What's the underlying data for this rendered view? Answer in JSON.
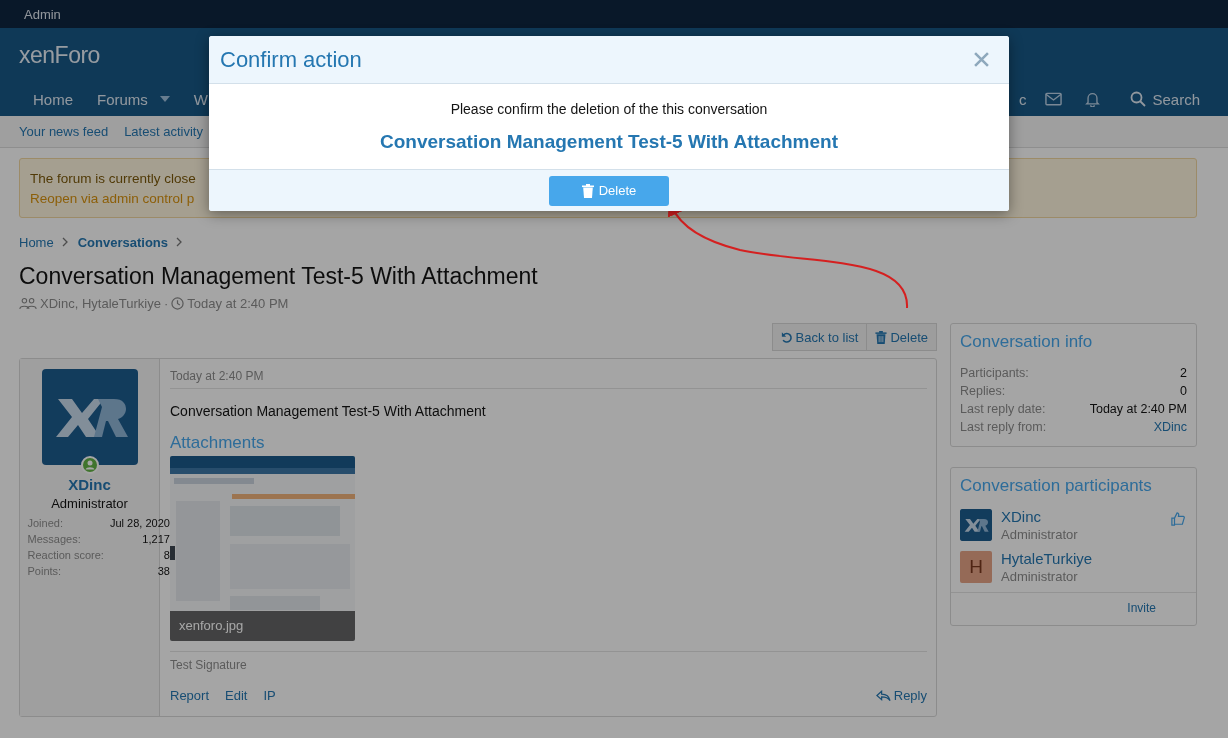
{
  "top_bar": {
    "label": "Admin"
  },
  "header": {
    "logo": "xenForo"
  },
  "nav": {
    "items": [
      {
        "label": "Home",
        "kind": "plain"
      },
      {
        "label": "Forums",
        "kind": "dropdown"
      },
      {
        "label": "W",
        "kind": "plain"
      }
    ],
    "user_fragment": "c",
    "search": "Search"
  },
  "sub_nav": [
    "Your news feed",
    "Latest activity"
  ],
  "notice": {
    "lines": [
      {
        "text": "The forum is currently close",
        "kind": "text"
      },
      {
        "text": "Reopen via admin control p",
        "kind": "link"
      }
    ]
  },
  "breadcrumbs": [
    {
      "label": "Home",
      "current": false
    },
    {
      "label": "Conversations",
      "current": true
    }
  ],
  "title": "Conversation Management Test-5 With Attachment",
  "meta": {
    "participants": "XDinc, HytaleTurkiye",
    "separator": "·",
    "time": "Today at 2:40 PM"
  },
  "actions": [
    {
      "label": "Back to list",
      "kind": "back"
    },
    {
      "label": "Delete",
      "kind": "delete"
    }
  ],
  "message": {
    "author": {
      "name": "XDinc",
      "role": "Administrator",
      "online": true,
      "stats": [
        {
          "label": "Joined:",
          "value": "Jul 28, 2020"
        },
        {
          "label": "Messages:",
          "value": "1,217"
        },
        {
          "label": "Reaction score:",
          "value": "8"
        },
        {
          "label": "Points:",
          "value": "38"
        }
      ]
    },
    "time": "Today at 2:40 PM",
    "body": "Conversation Management Test-5 With Attachment",
    "attachments_heading": "Attachments",
    "attachment": {
      "kind": "picture",
      "filename": "xenforo.jpg"
    },
    "signature": "Test Signature",
    "links": [
      "Report",
      "Edit",
      "IP"
    ],
    "reply": "Reply"
  },
  "sidebar": {
    "info": {
      "title": "Conversation info",
      "rows": [
        {
          "label": "Participants:",
          "value": "2",
          "kind": "text"
        },
        {
          "label": "Replies:",
          "value": "0",
          "kind": "text"
        },
        {
          "label": "Last reply date:",
          "value": "Today at 2:40 PM",
          "kind": "text"
        },
        {
          "label": "Last reply from:",
          "value": "XDinc",
          "kind": "link"
        }
      ]
    },
    "participants": {
      "title": "Conversation participants",
      "people": [
        {
          "name": "XDinc",
          "role": "Administrator",
          "kind": "logo",
          "liked": true
        },
        {
          "name": "HytaleTurkiye",
          "role": "Administrator",
          "kind": "letter",
          "letter": "H",
          "liked": false
        }
      ],
      "footer": "Invite"
    }
  },
  "modal": {
    "title": "Confirm action",
    "message": "Please confirm the deletion of the this conversation",
    "item": "Conversation Management Test-5 With Attachment",
    "button": "Delete"
  }
}
